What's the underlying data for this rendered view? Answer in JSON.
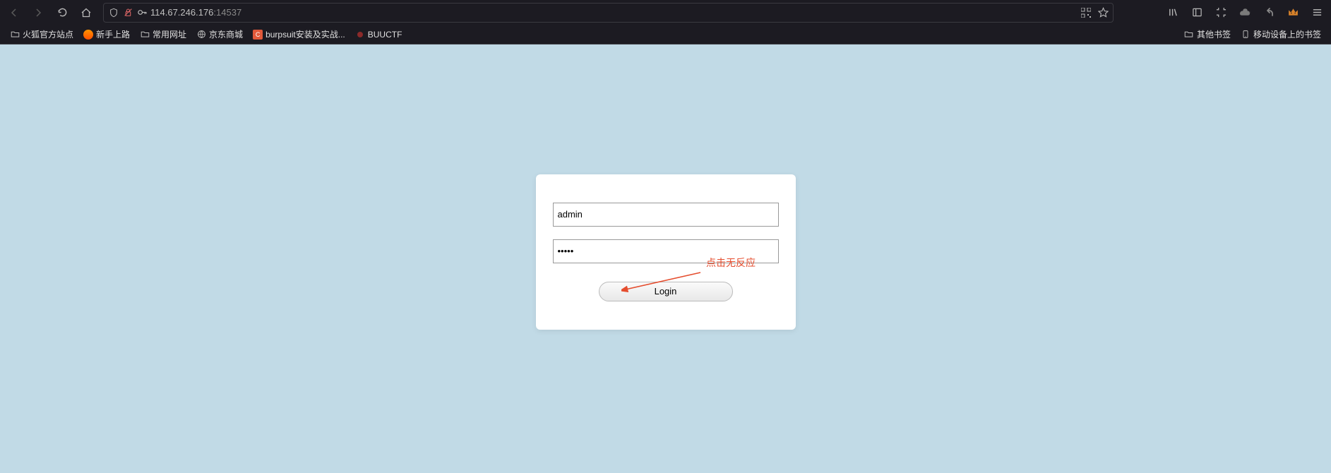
{
  "nav": {
    "url_host": "114.67.246.176",
    "url_port": ":14537"
  },
  "bookmarks": {
    "items": [
      {
        "label": "火狐官方站点",
        "favicon": "folder"
      },
      {
        "label": "新手上路",
        "favicon": "firefox"
      },
      {
        "label": "常用网址",
        "favicon": "folder"
      },
      {
        "label": "京东商城",
        "favicon": "globe"
      },
      {
        "label": "burpsuit安装及实战...",
        "favicon": "c-orange"
      },
      {
        "label": "BUUCTF",
        "favicon": "dot-red"
      }
    ],
    "right": [
      {
        "label": "其他书签"
      },
      {
        "label": "移动设备上的书签"
      }
    ]
  },
  "login": {
    "username_value": "admin",
    "password_value": "•••••",
    "button_label": "Login"
  },
  "annotation": {
    "text": "点击无反应"
  }
}
